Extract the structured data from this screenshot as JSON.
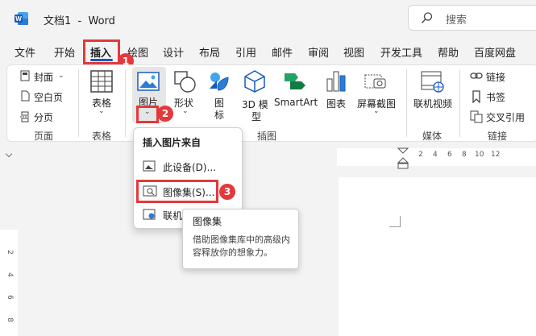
{
  "title_bar": {
    "title": "文档1  -  Word",
    "search_placeholder": "搜索"
  },
  "menu": [
    "文件",
    "开始",
    "插入",
    "绘图",
    "设计",
    "布局",
    "引用",
    "邮件",
    "审阅",
    "视图",
    "开发工具",
    "帮助",
    "百度网盘"
  ],
  "ribbon": {
    "pages": {
      "cover": "封面",
      "blank": "空白页",
      "break": "分页",
      "group": "页面"
    },
    "table": {
      "label": "表格",
      "group": "表格"
    },
    "illustrations": {
      "picture": "图片",
      "shapes": "形状",
      "icons_line1": "图",
      "icons_line2": "标",
      "model_line1": "3D 模",
      "model_line2": "型",
      "smartart": "SmartArt",
      "chart": "图表",
      "screenshot": "屏幕截图",
      "group": "插图"
    },
    "media": {
      "online_video": "联机视频",
      "group": "媒体"
    },
    "links": {
      "link": "链接",
      "bookmark": "书签",
      "cross_ref": "交叉引用",
      "group": "链接"
    }
  },
  "dropdown": {
    "header": "插入图片来自",
    "items": [
      "此设备(D)...",
      "图像集(S)...",
      "联机"
    ]
  },
  "tooltip": {
    "title": "图像集",
    "description": "借助图像集库中的高级内容释放你的想象力。"
  },
  "badges": [
    "1",
    "2",
    "3"
  ],
  "ruler": {
    "top": [
      "2",
      "4",
      "6",
      "8",
      "10",
      "12"
    ],
    "left": [
      "2",
      "4",
      "6",
      "8"
    ]
  },
  "colors": {
    "accent": "#185abd",
    "highlight": "#e5383b",
    "word_blue": "#2b579a"
  }
}
